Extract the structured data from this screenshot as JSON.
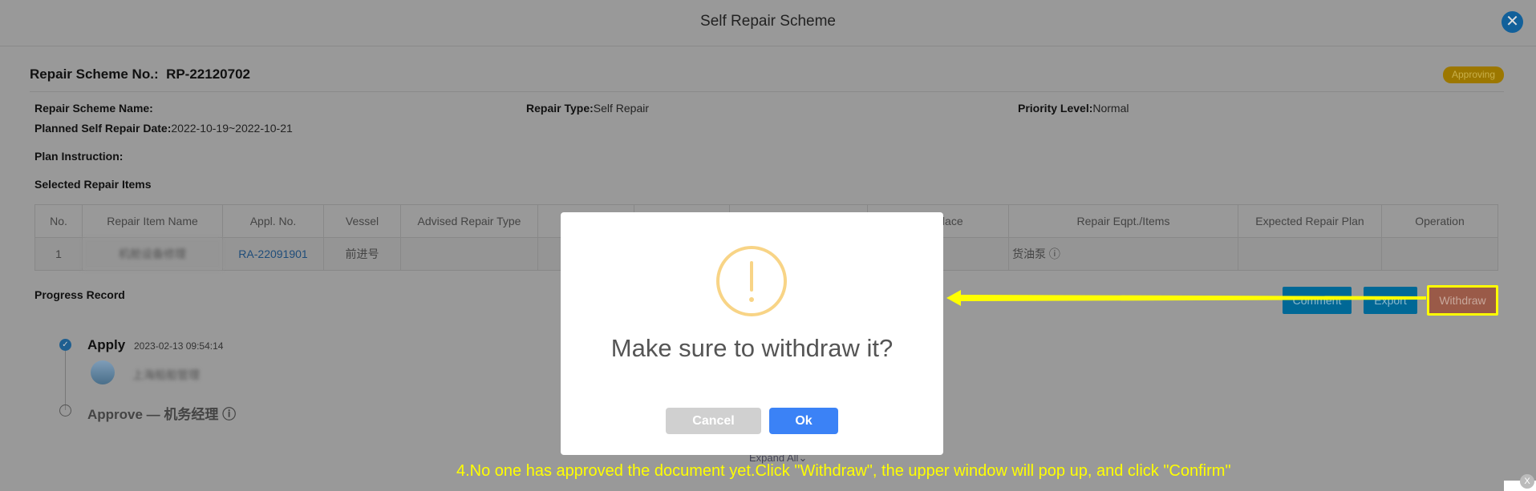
{
  "window": {
    "title": "Self Repair Scheme",
    "close_icon": "close-icon"
  },
  "header": {
    "scheme_no_label": "Repair Scheme No.:",
    "scheme_no": "RP-22120702",
    "status": "Approving",
    "status_color": "#9c7700"
  },
  "info": {
    "name_label": "Repair Scheme Name:",
    "name_value": "",
    "type_label": "Repair Type:",
    "type_value": "Self Repair",
    "priority_label": "Priority Level:",
    "priority_value": "Normal",
    "date_label": "Planned Self Repair Date:",
    "date_value": "2022-10-19~2022-10-21",
    "instruction_label": "Plan Instruction:",
    "instruction_value": ""
  },
  "table": {
    "title": "Selected Repair Items",
    "columns": [
      "No.",
      "Repair Item Name",
      "Appl. No.",
      "Vessel",
      "Advised Repair Type",
      "P",
      "",
      "",
      "pair Place",
      "Repair Eqpt./Items",
      "Expected Repair Plan",
      "Operation"
    ],
    "rows": [
      {
        "no": "1",
        "item_name": "机舱设备修理",
        "appl_no": "RA-22091901",
        "vessel": "前进号",
        "advised": "",
        "c6": "",
        "c7": "",
        "c8": "",
        "place": "",
        "eqpt": "货油泵 ⓘ",
        "plan": "",
        "operation": ""
      }
    ]
  },
  "progress": {
    "title": "Progress Record",
    "steps": [
      {
        "label": "Apply",
        "time": "2023-02-13 09:54:14",
        "user": "上海船舶管理",
        "done": true
      },
      {
        "label": "Approve — 机务经理 ⓘ",
        "done": false
      }
    ],
    "expand": "Expand All"
  },
  "actions": {
    "comment": "Comment",
    "export": "Export",
    "withdraw": "Withdraw"
  },
  "dialog": {
    "icon": "warning-icon",
    "message": "Make sure to withdraw it?",
    "cancel": "Cancel",
    "ok": "Ok",
    "ok_color": "#3b82f6"
  },
  "annotation": {
    "caption": "4.No one has approved the document yet.Click \"Withdraw\", the upper window will pop up, and click \"Confirm\"",
    "color": "#ffff00",
    "close": "X"
  }
}
